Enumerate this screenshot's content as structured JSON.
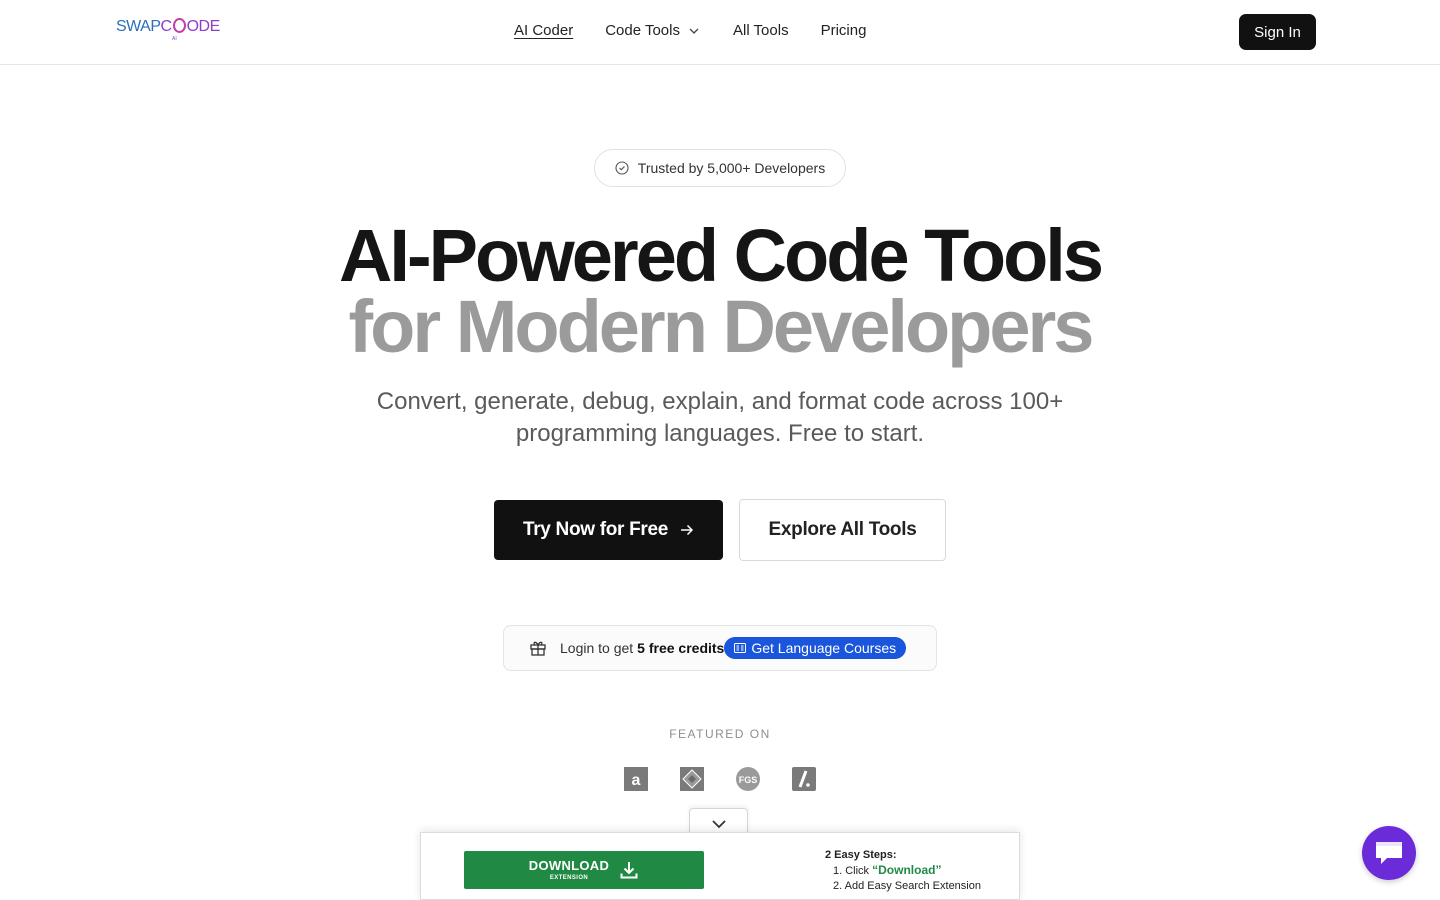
{
  "header": {
    "logo_text_a": "SWAP",
    "logo_text_b": "ODE",
    "logo_sub": "AI",
    "nav": {
      "ai_coder": "AI Coder",
      "code_tools": "Code Tools",
      "all_tools": "All Tools",
      "pricing": "Pricing"
    },
    "signin_label": "Sign In"
  },
  "hero": {
    "trusted_badge": "Trusted by 5,000+ Developers",
    "title_line1": "AI-Powered Code Tools",
    "title_line2": "for Modern Developers",
    "subtitle_line1": "Convert, generate, debug, explain, and format code across 100+",
    "subtitle_line2": "programming languages. Free to start.",
    "primary_cta": "Try Now for Free",
    "secondary_cta": "Explore All Tools"
  },
  "credits": {
    "text": "Login to get",
    "bold": "5 free credits",
    "badge": "Get Language Courses"
  },
  "featured": {
    "label": "FEATURED ON",
    "logos": [
      "a",
      "◇",
      "FGS",
      "/."
    ]
  },
  "extension": {
    "download_main": "DOWNLOAD",
    "download_sub": "EXTENSION",
    "steps_title": "2 Easy Steps:",
    "step1_prefix": "1. Click",
    "step1_highlight": "“Download”",
    "step2": "2. Add Easy Search Extension"
  },
  "colors": {
    "primary": "#111111",
    "muted_title": "#9b9b9b",
    "badge_blue": "#1a56db",
    "download_green": "#208a44",
    "chat_purple": "#6c2bd9"
  }
}
